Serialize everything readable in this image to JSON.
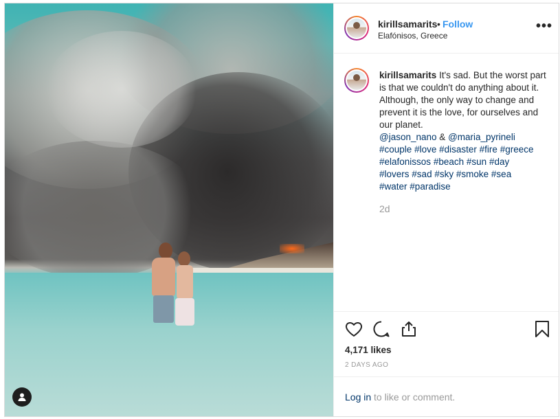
{
  "post": {
    "username": "kirillsamarits",
    "separator": "•",
    "follow_label": "Follow",
    "location": "Elafónisos, Greece",
    "more_label": "•••"
  },
  "caption": {
    "username": "kirillsamarits",
    "text": "It's sad. But the worst part is that we couldn't do anything about it. Although, the only way to change and prevent it is the love, for ourselves and our planet.",
    "mentions": [
      "@jason_nano",
      "@maria_pyrineli"
    ],
    "mention_joiner": "&",
    "hashtags": [
      "#couple",
      "#love",
      "#disaster",
      "#fire",
      "#greece",
      "#elafonissos",
      "#beach",
      "#sun",
      "#day",
      "#lovers",
      "#sad",
      "#sky",
      "#smoke",
      "#sea",
      "#water",
      "#paradise"
    ],
    "age": "2d"
  },
  "stats": {
    "likes": "4,171 likes",
    "posted": "2 DAYS AGO"
  },
  "login": {
    "link_label": "Log in",
    "rest": " to like or comment."
  },
  "icons": {
    "like": "heart-icon",
    "comment": "comment-icon",
    "share": "share-icon",
    "save": "bookmark-icon",
    "user_tag": "user-tag-icon"
  },
  "colors": {
    "follow": "#3897f0",
    "link": "#003569",
    "muted": "#999999",
    "text": "#262626"
  }
}
